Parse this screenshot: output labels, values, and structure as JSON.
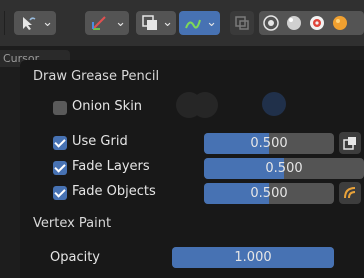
{
  "toolbar": {
    "icons": [
      "draw-pointer-icon",
      "transform-gizmo-icon",
      "overlay-icon",
      "stroke-placement-icon",
      "toggle-xray-icon",
      "shading-wireframe-icon",
      "shading-solid-icon",
      "shading-material-icon",
      "shading-rendered-icon"
    ],
    "active_color": "#4772b3"
  },
  "cursor_tag": "Cursor",
  "popup": {
    "draw_section": "Draw Grease Pencil",
    "onion_skin": {
      "label": "Onion Skin",
      "checked": false
    },
    "use_grid": {
      "label": "Use Grid",
      "checked": true,
      "value": "0.500",
      "fraction": 0.5
    },
    "fade_layers": {
      "label": "Fade Layers",
      "checked": true,
      "value": "0.500",
      "fraction": 0.5
    },
    "fade_objects": {
      "label": "Fade Objects",
      "checked": true,
      "value": "0.500",
      "fraction": 0.5
    },
    "vertex_section": "Vertex Paint",
    "opacity": {
      "label": "Opacity",
      "value": "1.000",
      "fraction": 1.0
    }
  }
}
